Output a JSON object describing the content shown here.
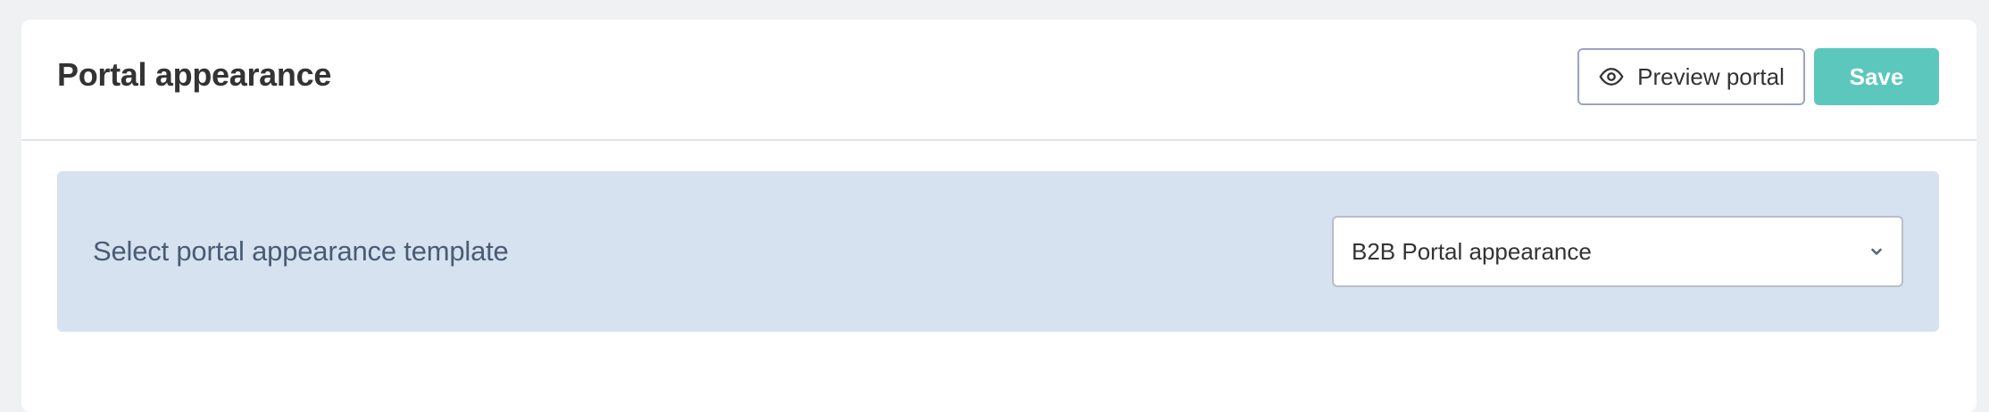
{
  "header": {
    "title": "Portal appearance",
    "preview_label": "Preview portal",
    "preview_icon": "eye-icon",
    "save_label": "Save"
  },
  "template_panel": {
    "label": "Select portal appearance template",
    "selected_value": "B2B Portal appearance",
    "dropdown_icon": "chevron-down-icon"
  },
  "colors": {
    "accent": "#5cc7bd",
    "panel_background": "#d7e2f0",
    "label_text": "#4a5b74"
  }
}
